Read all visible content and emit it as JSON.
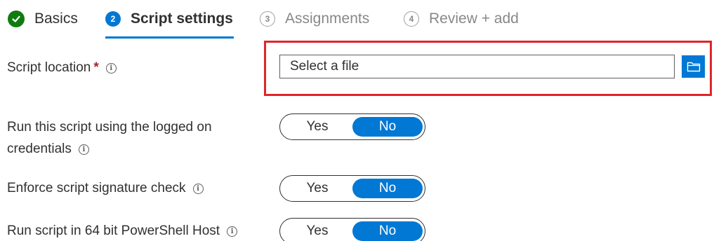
{
  "wizard": {
    "steps": [
      {
        "number": "",
        "label": "Basics",
        "state": "completed"
      },
      {
        "number": "2",
        "label": "Script settings",
        "state": "current"
      },
      {
        "number": "3",
        "label": "Assignments",
        "state": "pending"
      },
      {
        "number": "4",
        "label": "Review + add",
        "state": "pending"
      }
    ]
  },
  "form": {
    "script_location": {
      "label": "Script location",
      "required_marker": "*",
      "placeholder": "Select a file",
      "value": "",
      "browse_icon": "folder-icon"
    },
    "run_as_logged_on": {
      "label_line1": "Run this script using the logged on",
      "label_line2": "credentials",
      "yes_label": "Yes",
      "no_label": "No",
      "selected": "No"
    },
    "signature_check": {
      "label": "Enforce script signature check",
      "yes_label": "Yes",
      "no_label": "No",
      "selected": "No"
    },
    "run_64bit": {
      "label": "Run script in 64 bit PowerShell Host",
      "yes_label": "Yes",
      "no_label": "No",
      "selected": "No"
    }
  },
  "colors": {
    "accent": "#0078d4",
    "success": "#107c10",
    "highlight": "#e0252a",
    "required": "#a4262c"
  }
}
